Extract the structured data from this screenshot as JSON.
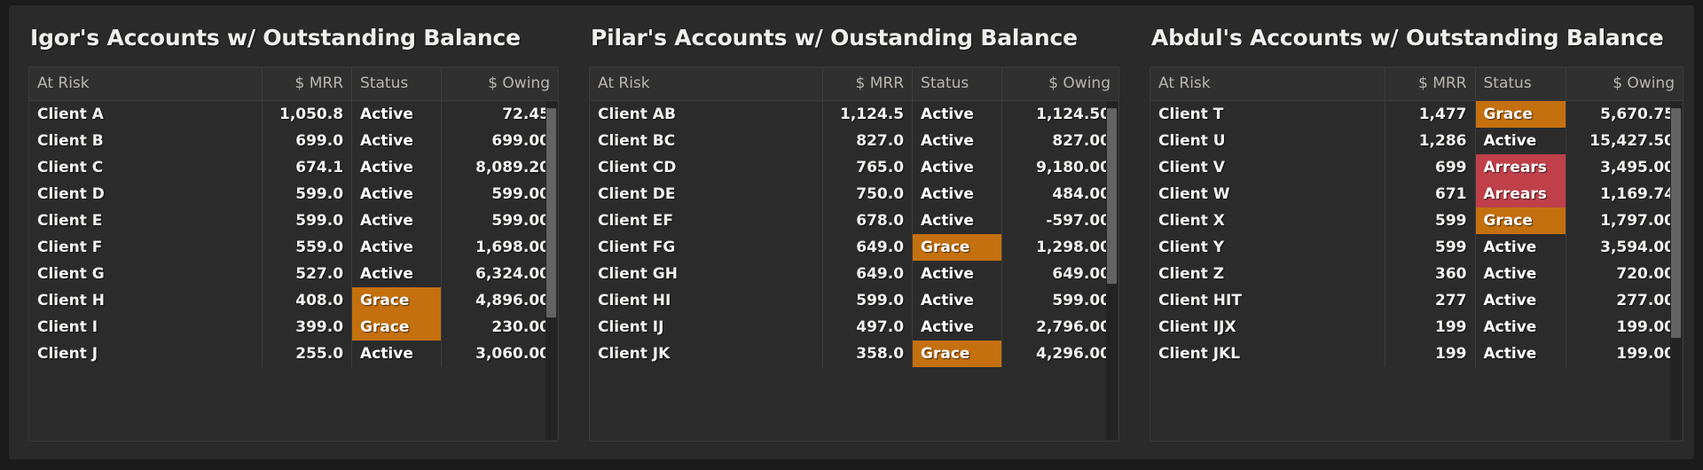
{
  "theme": {
    "page_background": "#1b1b1b",
    "panel_background": "#2a2a2a",
    "table_background": "#2b2b2b",
    "header_background": "#303030",
    "grid_line": "#3d3d3d",
    "text_primary": "#f2f1ef",
    "text_header": "#b9b6b1",
    "status_grace_color": "#c4700f",
    "status_arrears_color": "#bf4049",
    "scrollbar_thumb": "#636363",
    "scrollbar_track": "#232323"
  },
  "columns": [
    "At Risk",
    "$ MRR",
    "Status",
    "$ Owing"
  ],
  "panels": [
    {
      "title": "Igor's Accounts w/ Outstanding Balance",
      "columns": [
        "At Risk",
        "$ MRR",
        "Status",
        "$ Owing"
      ],
      "scroll_thumb_top_pct": 2,
      "scroll_thumb_height_pct": 62,
      "rows": [
        {
          "name": "Client A",
          "mrr": "1,050.8",
          "status": "Active",
          "owing": "72.45"
        },
        {
          "name": "Client B",
          "mrr": "699.0",
          "status": "Active",
          "owing": "699.00"
        },
        {
          "name": "Client C",
          "mrr": "674.1",
          "status": "Active",
          "owing": "8,089.20"
        },
        {
          "name": "Client D",
          "mrr": "599.0",
          "status": "Active",
          "owing": "599.00"
        },
        {
          "name": "Client E",
          "mrr": "599.0",
          "status": "Active",
          "owing": "599.00"
        },
        {
          "name": "Client F",
          "mrr": "559.0",
          "status": "Active",
          "owing": "1,698.00"
        },
        {
          "name": "Client G",
          "mrr": "527.0",
          "status": "Active",
          "owing": "6,324.00"
        },
        {
          "name": "Client H",
          "mrr": "408.0",
          "status": "Grace",
          "owing": "4,896.00"
        },
        {
          "name": "Client I",
          "mrr": "399.0",
          "status": "Grace",
          "owing": "230.00"
        },
        {
          "name": "Client J",
          "mrr": "255.0",
          "status": "Active",
          "owing": "3,060.00"
        }
      ]
    },
    {
      "title": "Pilar's Accounts w/ Oustanding Balance",
      "columns": [
        "At Risk",
        "$ MRR",
        "Status",
        "$ Owing"
      ],
      "scroll_thumb_top_pct": 2,
      "scroll_thumb_height_pct": 52,
      "rows": [
        {
          "name": "Client AB",
          "mrr": "1,124.5",
          "status": "Active",
          "owing": "1,124.50"
        },
        {
          "name": "Client BC",
          "mrr": "827.0",
          "status": "Active",
          "owing": "827.00"
        },
        {
          "name": "Client CD",
          "mrr": "765.0",
          "status": "Active",
          "owing": "9,180.00"
        },
        {
          "name": "Client DE",
          "mrr": "750.0",
          "status": "Active",
          "owing": "484.00"
        },
        {
          "name": "Client EF",
          "mrr": "678.0",
          "status": "Active",
          "owing": "-597.00"
        },
        {
          "name": "Client FG",
          "mrr": "649.0",
          "status": "Grace",
          "owing": "1,298.00"
        },
        {
          "name": "Client GH",
          "mrr": "649.0",
          "status": "Active",
          "owing": "649.00"
        },
        {
          "name": "Client HI",
          "mrr": "599.0",
          "status": "Active",
          "owing": "599.00"
        },
        {
          "name": "Client IJ",
          "mrr": "497.0",
          "status": "Active",
          "owing": "2,796.00"
        },
        {
          "name": "Client JK",
          "mrr": "358.0",
          "status": "Grace",
          "owing": "4,296.00"
        }
      ]
    },
    {
      "title": "Abdul's Accounts w/ Outstanding Balance",
      "columns": [
        "At Risk",
        "$ MRR",
        "Status",
        "$ Owing"
      ],
      "scroll_thumb_top_pct": 2,
      "scroll_thumb_height_pct": 68,
      "rows": [
        {
          "name": "Client T",
          "mrr": "1,477",
          "status": "Grace",
          "owing": "5,670.75"
        },
        {
          "name": "Client U",
          "mrr": "1,286",
          "status": "Active",
          "owing": "15,427.50"
        },
        {
          "name": "Client V",
          "mrr": "699",
          "status": "Arrears",
          "owing": "3,495.00"
        },
        {
          "name": "Client W",
          "mrr": "671",
          "status": "Arrears",
          "owing": "1,169.74"
        },
        {
          "name": "Client X",
          "mrr": "599",
          "status": "Grace",
          "owing": "1,797.00"
        },
        {
          "name": "Client Y",
          "mrr": "599",
          "status": "Active",
          "owing": "3,594.00"
        },
        {
          "name": "Client Z",
          "mrr": "360",
          "status": "Active",
          "owing": "720.00"
        },
        {
          "name": "Client HIT",
          "mrr": "277",
          "status": "Active",
          "owing": "277.00"
        },
        {
          "name": "Client IJX",
          "mrr": "199",
          "status": "Active",
          "owing": "199.00"
        },
        {
          "name": "Client JKL",
          "mrr": "199",
          "status": "Active",
          "owing": "199.00"
        }
      ]
    }
  ]
}
